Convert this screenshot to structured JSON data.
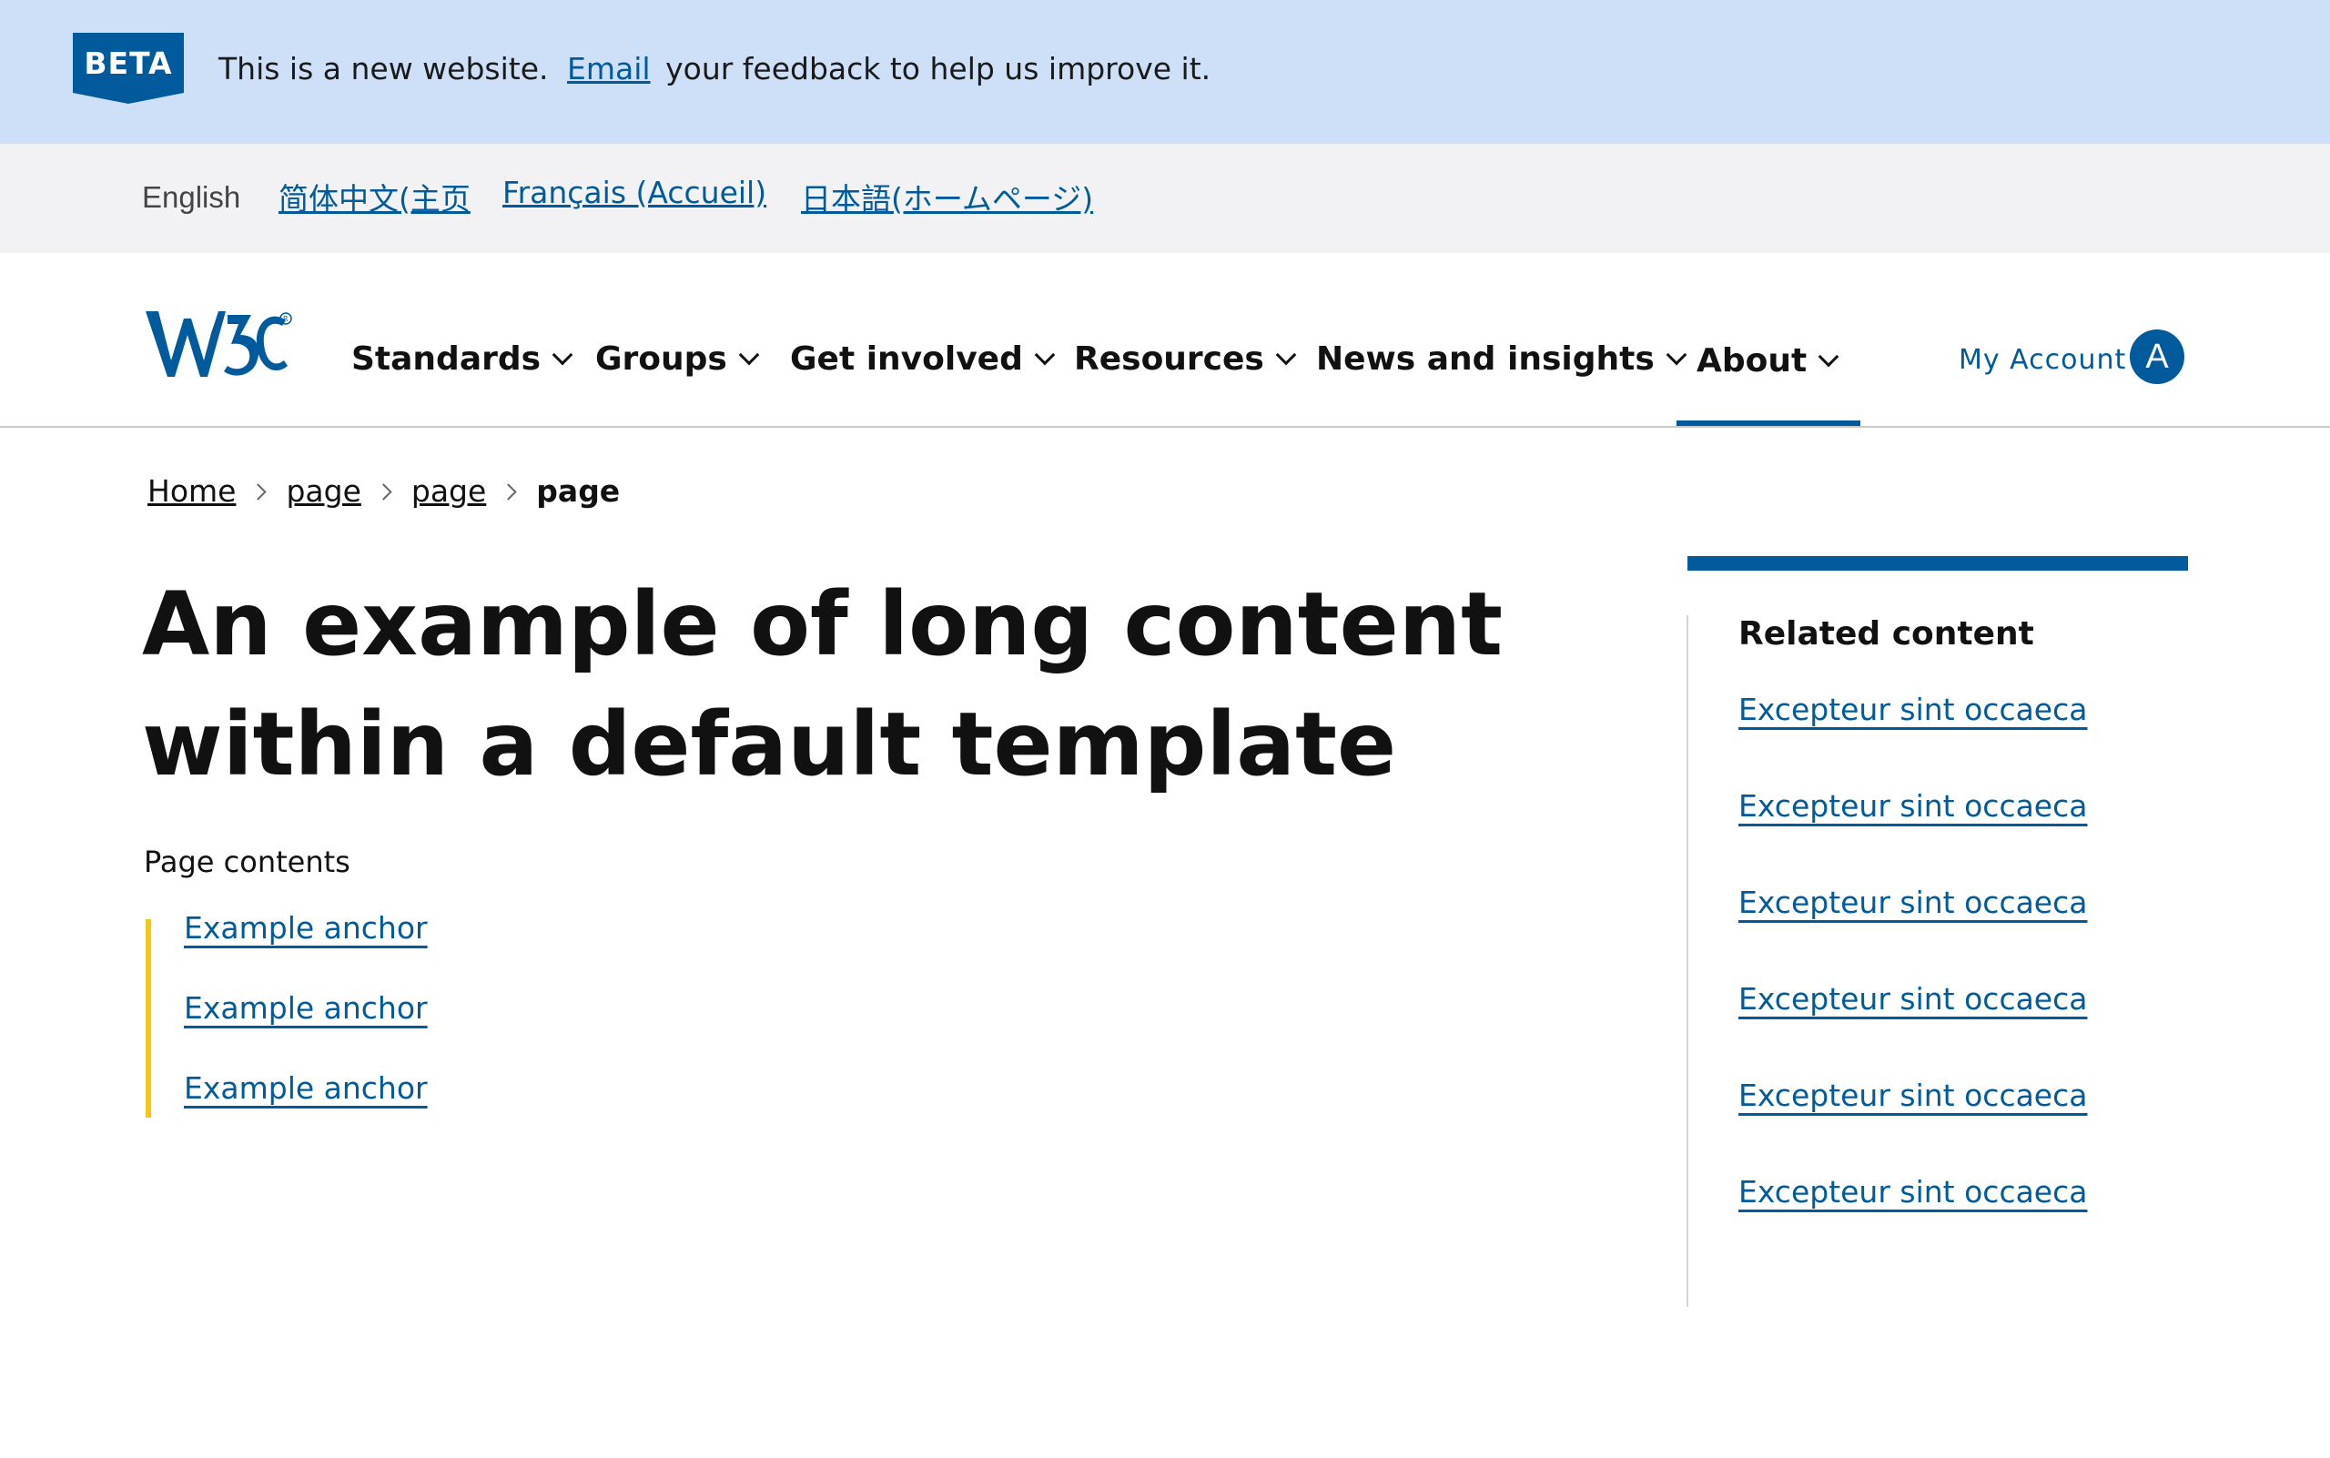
{
  "beta": {
    "badge": "BETA",
    "message_before": "This is a new website.",
    "link": "Email",
    "message_after": "your feedback to help us improve it."
  },
  "languages": {
    "current": "English",
    "links": [
      "简体中文(主页",
      "Français (Accueil)",
      "日本語(ホームページ)"
    ]
  },
  "header": {
    "logo_alt": "W3C",
    "nav": [
      "Standards",
      "Groups",
      "Get involved",
      "Resources",
      "News and insights",
      "About"
    ],
    "active_nav": "About",
    "account_label": "My Account",
    "avatar_initial": "A"
  },
  "breadcrumb": {
    "items": [
      "Home",
      "page",
      "page"
    ],
    "current": "page"
  },
  "main": {
    "title": "An example of long content within a default template",
    "toc_heading": "Page contents",
    "toc_links": [
      "Example anchor",
      "Example anchor",
      "Example anchor"
    ]
  },
  "sidebar": {
    "heading": "Related content",
    "links": [
      "Excepteur sint occaeca",
      "Excepteur sint occaeca",
      "Excepteur sint occaeca",
      "Excepteur sint occaeca",
      "Excepteur sint occaeca",
      "Excepteur sint occaeca"
    ]
  },
  "colors": {
    "brand": "#005a9c",
    "beta_bg": "#cde0f8",
    "lang_bg": "#f2f2f4",
    "toc_accent": "#f2c81c"
  }
}
